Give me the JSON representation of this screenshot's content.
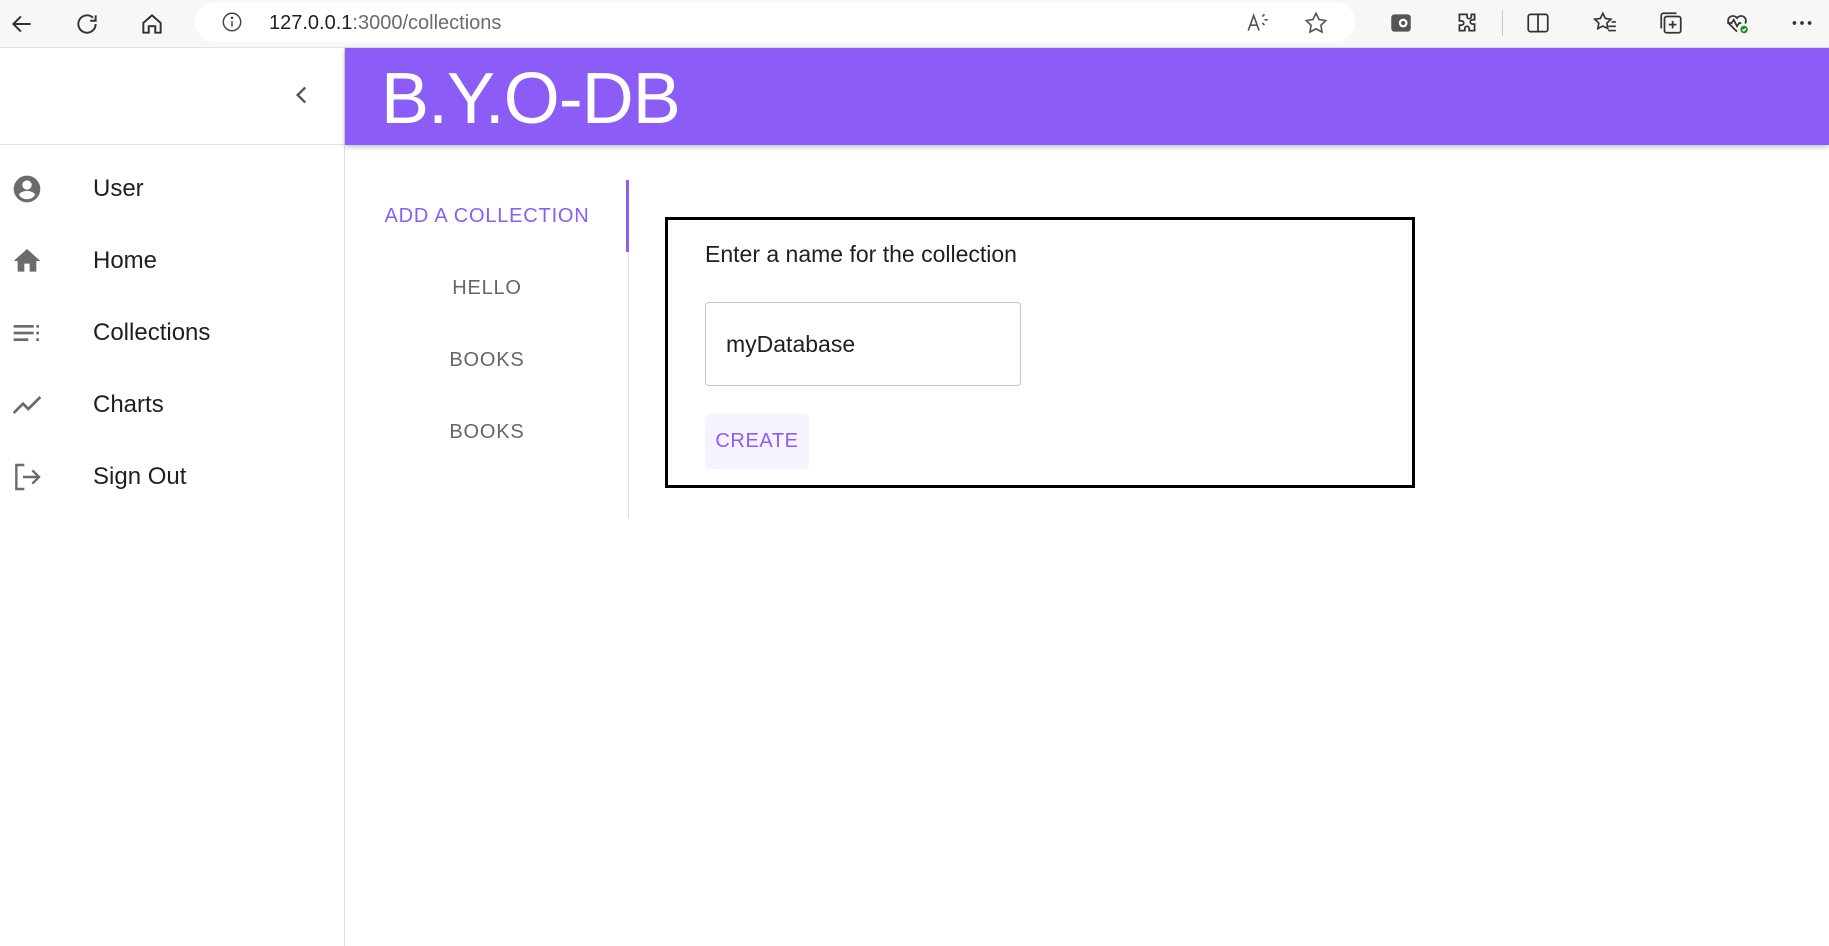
{
  "browser": {
    "url_host": "127.0.0.1",
    "url_path": ":3000/collections"
  },
  "app": {
    "title": "B.Y.O-DB",
    "accent": "#8b5cf6"
  },
  "sidebar": {
    "items": [
      {
        "label": "User",
        "icon": "account-circle-icon"
      },
      {
        "label": "Home",
        "icon": "home-icon"
      },
      {
        "label": "Collections",
        "icon": "list-icon"
      },
      {
        "label": "Charts",
        "icon": "trending-icon"
      },
      {
        "label": "Sign Out",
        "icon": "logout-icon"
      }
    ]
  },
  "tabs": [
    {
      "label": "ADD A COLLECTION",
      "active": true
    },
    {
      "label": "HELLO"
    },
    {
      "label": "BOOKS"
    },
    {
      "label": "BOOKS"
    }
  ],
  "form": {
    "label": "Enter a name for the collection",
    "input_value": "myDatabase",
    "create_label": "CREATE"
  }
}
